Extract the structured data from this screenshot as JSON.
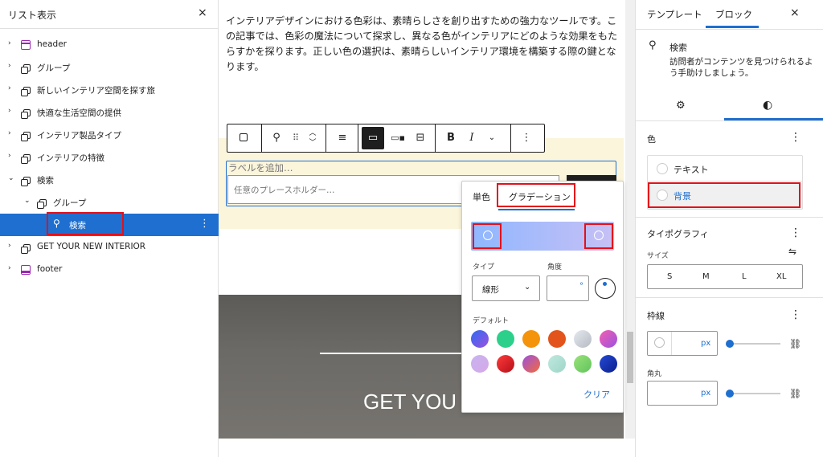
{
  "left_panel": {
    "title": "リスト表示",
    "close": "×",
    "items": [
      {
        "label": "header",
        "chev": "›",
        "icon": "header-icon"
      },
      {
        "label": "グループ",
        "chev": "›",
        "icon": "group-icon"
      },
      {
        "label": "新しいインテリア空間を探す旅",
        "chev": "›",
        "icon": "group-icon"
      },
      {
        "label": "快適な生活空間の提供",
        "chev": "›",
        "icon": "group-icon"
      },
      {
        "label": "インテリア製品タイプ",
        "chev": "›",
        "icon": "group-icon"
      },
      {
        "label": "インテリアの特徴",
        "chev": "›",
        "icon": "group-icon"
      },
      {
        "label": "検索",
        "chev": "⌄",
        "icon": "group-icon"
      },
      {
        "label": "グループ",
        "chev": "⌄",
        "icon": "group-icon"
      },
      {
        "label": "検索",
        "chev": "",
        "icon": "search-icon"
      },
      {
        "label": "GET YOUR NEW INTERIOR",
        "chev": "›",
        "icon": "group-icon"
      },
      {
        "label": "footer",
        "chev": "›",
        "icon": "footer-icon"
      }
    ]
  },
  "canvas": {
    "intro": "インテリアデザインにおける色彩は、素晴らしさを創り出すための強力なツールです。この記事では、色彩の魔法について探求し、異なる色がインテリアにどのような効果をもたらすかを探ります。正しい色の選択は、素晴らしいインテリア環境を構築する際の鍵となります。",
    "search_label": "ラベルを追加…",
    "search_placeholder": "任意のプレースホルダー…",
    "banner_title": "GET YOU"
  },
  "toolbar": {
    "bold": "B",
    "italic": "I"
  },
  "popover": {
    "tab_solid": "単色",
    "tab_gradient": "グラデーション",
    "type_label": "タイプ",
    "angle_label": "角度",
    "type_value": "線形",
    "angle_unit": "°",
    "default_label": "デフォルト",
    "clear": "クリア",
    "swatches": [
      "linear-gradient(135deg,#2f6bf0,#9b51e0)",
      "#2dd08a",
      "#f4930c",
      "#e2541c",
      "linear-gradient(135deg,#e6e9ee,#b4bac4)",
      "linear-gradient(135deg,#f35fb0,#9b51e0)",
      "linear-gradient(135deg,#c8b4f0,#d6a8e8)",
      "linear-gradient(135deg,#ff3a3a,#b5101a)",
      "linear-gradient(135deg,#9b51e0,#f36b3a)",
      "linear-gradient(135deg,#bfe8df,#9ed6c8)",
      "linear-gradient(135deg,#9be27a,#60c45c)",
      "linear-gradient(135deg,#2449d6,#0b1f8c)"
    ]
  },
  "right_panel": {
    "tab_template": "テンプレート",
    "tab_block": "ブロック",
    "close": "×",
    "block_name": "検索",
    "block_desc": "訪問者がコンテンツを見つけられるよう手助けしましょう。",
    "color_heading": "色",
    "color_text": "テキスト",
    "color_bg": "背景",
    "typography_heading": "タイポグラフィ",
    "size_label": "サイズ",
    "sizes": [
      "S",
      "M",
      "L",
      "XL"
    ],
    "border_heading": "枠線",
    "unit": "px",
    "radius_label": "角丸"
  },
  "colors": {
    "accent": "#1e6fcf",
    "highlight": "#e3101a",
    "canvas_bg": "#fbf5dc"
  }
}
